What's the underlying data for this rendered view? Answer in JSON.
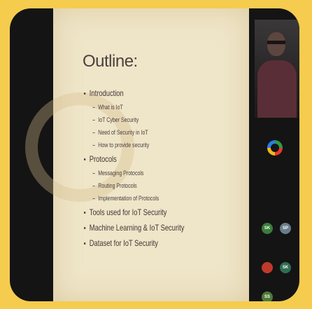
{
  "slide": {
    "title": "Outline:",
    "items": [
      {
        "label": "Introduction",
        "subitems": [
          "What is IoT",
          "IoT Cyber Security",
          "Need of Security in IoT",
          "How to provide security"
        ]
      },
      {
        "label": "Protocols",
        "subitems": [
          "Messaging Protocols",
          "Routing Protocols",
          "Implementation of Protocols"
        ]
      },
      {
        "label": "Tools used for IoT Security",
        "subitems": []
      },
      {
        "label": "Machine Learning & IoT Security",
        "subitems": []
      },
      {
        "label": "Dataset for IoT Security",
        "subitems": []
      }
    ]
  },
  "participants": [
    {
      "initials": "SK",
      "color": "#3a7d3a"
    },
    {
      "initials": "SP",
      "color": "#6a7d8a"
    },
    {
      "initials": "",
      "color": "#c0392b"
    },
    {
      "initials": "SK",
      "color": "#2f6e53"
    },
    {
      "initials": "SS",
      "color": "#4d7a3a"
    }
  ],
  "colors": {
    "background": "#f5cc4e",
    "frame": "#141414",
    "slide": "#efe5c8"
  }
}
